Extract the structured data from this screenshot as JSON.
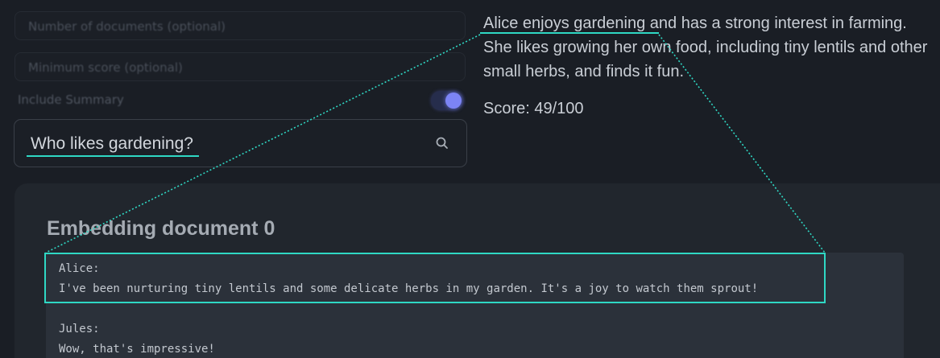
{
  "left_panel": {
    "num_documents_placeholder": "Number of documents (optional)",
    "min_score_placeholder": "Minimum score (optional)",
    "include_summary_label": "Include Summary",
    "include_summary_on": true,
    "search_value": "Who likes gardening?",
    "search_icon": "search-icon"
  },
  "result": {
    "summary": "Alice enjoys gardening and has a strong interest in farming. She likes growing her own food, including tiny lentils and other small herbs, and finds it fun.",
    "score": "Score: 49/100"
  },
  "document": {
    "title": "Embedding document 0",
    "lines": [
      "Alice:",
      "I've been nurturing tiny lentils and some delicate herbs in my garden. It's a joy to watch them sprout!",
      "",
      "Jules:",
      "Wow, that's impressive!"
    ]
  },
  "colors": {
    "accent": "#2fd8c4",
    "toggle_knob": "#7c84f5",
    "background": "#1a1e25",
    "card": "#21262d",
    "code_bg": "#2b313a"
  }
}
